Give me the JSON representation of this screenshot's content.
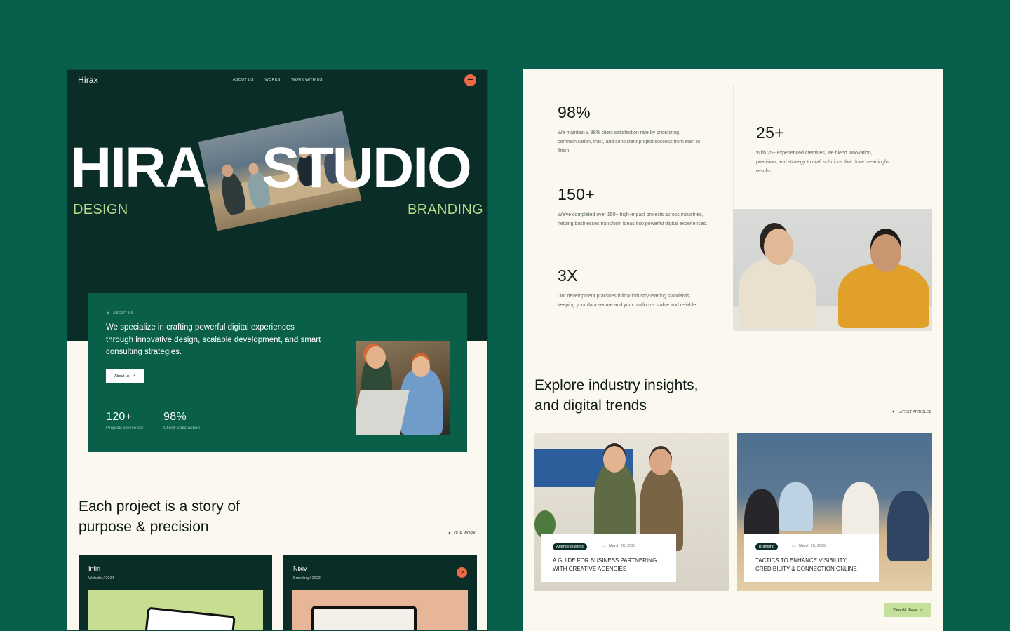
{
  "colors": {
    "background": "#07604b",
    "hero_dark": "#0b2d28",
    "accent_green": "#0a5f49",
    "lime": "#b6d98a",
    "orange": "#ec6a46",
    "cream": "#fbf8ef"
  },
  "left": {
    "nav": {
      "logo": "Hirax",
      "items": [
        "ABOUT US",
        "WORKS",
        "WORK WITH US"
      ]
    },
    "hero": {
      "title_left": "HIRA",
      "title_right": "STUDIO",
      "sub_left": "DESIGN",
      "sub_right": "BRANDING"
    },
    "about": {
      "tag": "ABOUT US",
      "text": "We specialize in crafting powerful digital experiences through innovative design, scalable development, and smart consulting strategies.",
      "button": "About us",
      "stats": [
        {
          "num": "120+",
          "label": "Projects Delivered"
        },
        {
          "num": "98%",
          "label": "Client Satisfaction"
        }
      ]
    },
    "projects": {
      "title_line1": "Each project is a story of",
      "title_line2": "purpose & precision",
      "tag": "OUR WORK",
      "cards": [
        {
          "name": "Intiri",
          "meta": "Website / 2024"
        },
        {
          "name": "Nixiv",
          "meta": "Branding / 2023"
        }
      ]
    }
  },
  "right": {
    "stats": [
      {
        "num": "98%",
        "desc": "We maintain a 98% client satisfaction rate by prioritizing communication, trust, and consistent project success from start to finish."
      },
      {
        "num": "25+",
        "desc": "With 25+ experienced creatives, we blend innovation, precision, and strategy to craft solutions that drive meaningful results."
      },
      {
        "num": "150+",
        "desc": "We've completed over 150+ high-impact projects across industries, helping businesses transform ideas into powerful digital experiences."
      },
      {
        "num": "3X",
        "desc": "Our development practices follow industry-leading standards, keeping your data secure and your platforms stable and reliable."
      }
    ],
    "insights": {
      "title_line1": "Explore industry insights,",
      "title_line2": "and digital trends",
      "tag": "LATEST ARTICLES",
      "blogs": [
        {
          "chip": "Agency Insights",
          "date": "March 20, 2025",
          "headline": "A GUIDE FOR BUSINESS PARTNERING WITH CREATIVE AGENCIES"
        },
        {
          "chip": "Branding",
          "date": "March 20, 2025",
          "headline": "TACTICS TO ENHANCE VISIBILITY, CREDIBILITY & CONNECTION ONLINE"
        }
      ],
      "view_all": "View All Blogs"
    }
  }
}
